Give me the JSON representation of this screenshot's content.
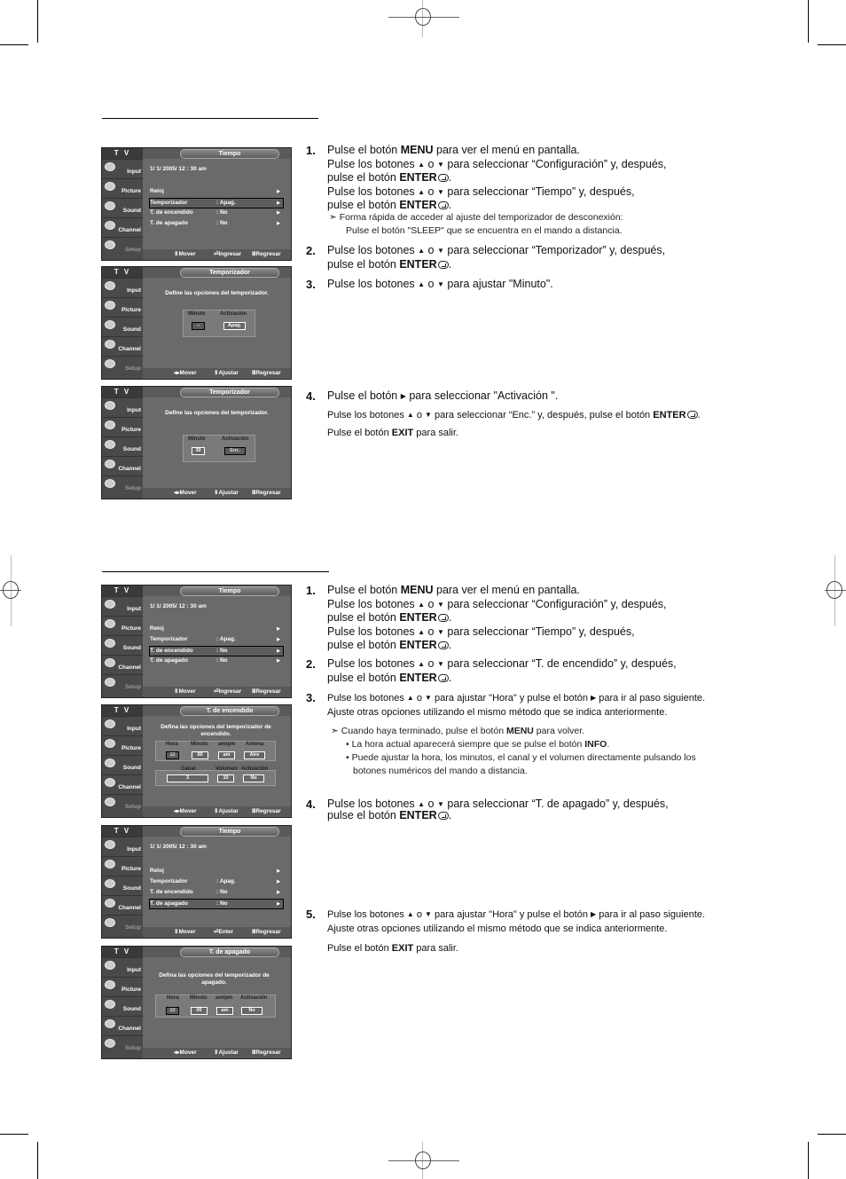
{
  "screens": {
    "common": {
      "tv_label": "T V",
      "sidebar": [
        "Input",
        "Picture",
        "Sound",
        "Channel",
        "Setup"
      ],
      "footer_mover": "Mover",
      "footer_ingresar": "Ingresar",
      "footer_enter": "Enter",
      "footer_regresar": "Regresar",
      "footer_ajustar": "Ajustar"
    },
    "tiempo": {
      "title": "Tiempo",
      "datetime": "1/ 1/ 2005/ 12 : 30 am",
      "items": [
        {
          "label": "Reloj",
          "value": ""
        },
        {
          "label": "Temporizador",
          "value": ": Apag."
        },
        {
          "label": "T. de encendido",
          "value": ": No"
        },
        {
          "label": "T. de apagado",
          "value": ": No"
        }
      ]
    },
    "temporizador": {
      "title": "Temporizador",
      "desc": "Define las opciones del temporizador.",
      "col_minuto": "Minuto",
      "col_activacion": "Activación",
      "s2_minuto": "--",
      "s2_activacion": "Apag.",
      "s3_minuto": "30",
      "s3_activacion": "Enc."
    },
    "encendido": {
      "title": "T. de encendido",
      "desc": "Defina las opciones del temporizador de encendido.",
      "headers": [
        "Hora",
        "Minuto",
        "am/pm",
        "Antena"
      ],
      "values": [
        "12",
        "00",
        "am",
        "Aire"
      ],
      "headers2": [
        "Canal",
        "Volumen",
        "Activación"
      ],
      "values2": [
        "3",
        "10",
        "No"
      ]
    },
    "apagado": {
      "title": "T. de apagado",
      "desc": "Defina las opciones del temporizador de apagado.",
      "headers": [
        "Hora",
        "Minuto",
        "am/pm",
        "Activación"
      ],
      "values": [
        "12",
        "00",
        "am",
        "No"
      ]
    }
  },
  "section1": {
    "step1": {
      "num": "1.",
      "l1a": "Pulse el botón ",
      "l1b": "MENU",
      "l1c": " para ver el menú en pantalla.",
      "l2a": "Pulse los botones ",
      "l2b": " o ",
      "l2c": " para seleccionar “Configuración” y, después,",
      "l3a": "pulse el botón ",
      "l3b": "ENTER",
      "l3c": ".",
      "l4a": "Pulse los botones ",
      "l4b": " o ",
      "l4c": " para seleccionar “Tiempo” y, después,",
      "l5a": "pulse el botón ",
      "l5b": "ENTER",
      "l5c": ".",
      "note1": "Forma rápida de acceder al ajuste del temporizador de desconexión:",
      "note2": "Pulse el botón \"SLEEP\" que se encuentra en el mando a distancia."
    },
    "step2": {
      "num": "2.",
      "l1a": "Pulse los botones ",
      "l1b": " o ",
      "l1c": " para seleccionar “Temporizador” y, después,",
      "l2a": "pulse el botón ",
      "l2b": "ENTER",
      "l2c": "."
    },
    "step3": {
      "num": "3.",
      "l1a": "Pulse los botones ",
      "l1b": " o ",
      "l1c": " para ajustar \"Minuto\"."
    },
    "step4": {
      "num": "4.",
      "l1a": "Pulse el botón ",
      "l1b": " para seleccionar \"Activación \".",
      "l2a": "Pulse los botones ",
      "l2b": " o ",
      "l2c": " para seleccionar “Enc.” y, después, pulse el botón ",
      "l2d": "ENTER",
      "l2e": ".",
      "l3a": "Pulse el botón ",
      "l3b": "EXIT",
      "l3c": " para salir."
    }
  },
  "section2": {
    "step1": {
      "num": "1.",
      "l1a": "Pulse el botón ",
      "l1b": "MENU",
      "l1c": " para ver el menú en pantalla.",
      "l2a": "Pulse los botones ",
      "l2b": " o ",
      "l2c": " para seleccionar “Configuración” y, después,",
      "l3a": "pulse el botón ",
      "l3b": "ENTER",
      "l3c": ".",
      "l4a": "Pulse los botones ",
      "l4b": " o ",
      "l4c": " para seleccionar “Tiempo” y, después,",
      "l5a": "pulse el botón ",
      "l5b": "ENTER",
      "l5c": "."
    },
    "step2": {
      "num": "2.",
      "l1a": "Pulse los botones ",
      "l1b": " o ",
      "l1c": " para seleccionar “T. de encendido” y, después,",
      "l2a": "pulse el botón ",
      "l2b": "ENTER",
      "l2c": "."
    },
    "step3": {
      "num": "3.",
      "l1a": "Pulse los botones ",
      "l1b": " o ",
      "l1c": " para ajustar \"Hora\" y pulse el botón ",
      "l1d": " para ir al paso siguiente.",
      "l2": "Ajuste otras opciones utilizando el mismo método que se indica anteriormente.",
      "note1a": "Cuando haya terminado, pulse el botón ",
      "note1b": "MENU",
      "note1c": " para volver.",
      "bullet1a": "• La hora actual aparecerá siempre que se pulse el botón ",
      "bullet1b": "INFO",
      "bullet1c": ".",
      "bullet2a": "• Puede ajustar la hora, los minutos, el canal y el volumen directamente pulsando los",
      "bullet2b": "botones numéricos del mando a distancia."
    },
    "step4": {
      "num": "4.",
      "l1a": "Pulse los botones ",
      "l1b": " o ",
      "l1c": " para seleccionar “T. de apagado” y, después,",
      "l2a": "pulse el botón ",
      "l2b": "ENTER",
      "l2c": "."
    },
    "step5": {
      "num": "5.",
      "l1a": "Pulse los botones ",
      "l1b": " o ",
      "l1c": " para ajustar \"Hora\" y pulse el botón ",
      "l1d": " para ir al paso siguiente.",
      "l2": "Ajuste otras opciones utilizando el mismo método que se indica anteriormente.",
      "l3a": "Pulse el botón ",
      "l3b": "EXIT",
      "l3c": " para salir."
    }
  }
}
